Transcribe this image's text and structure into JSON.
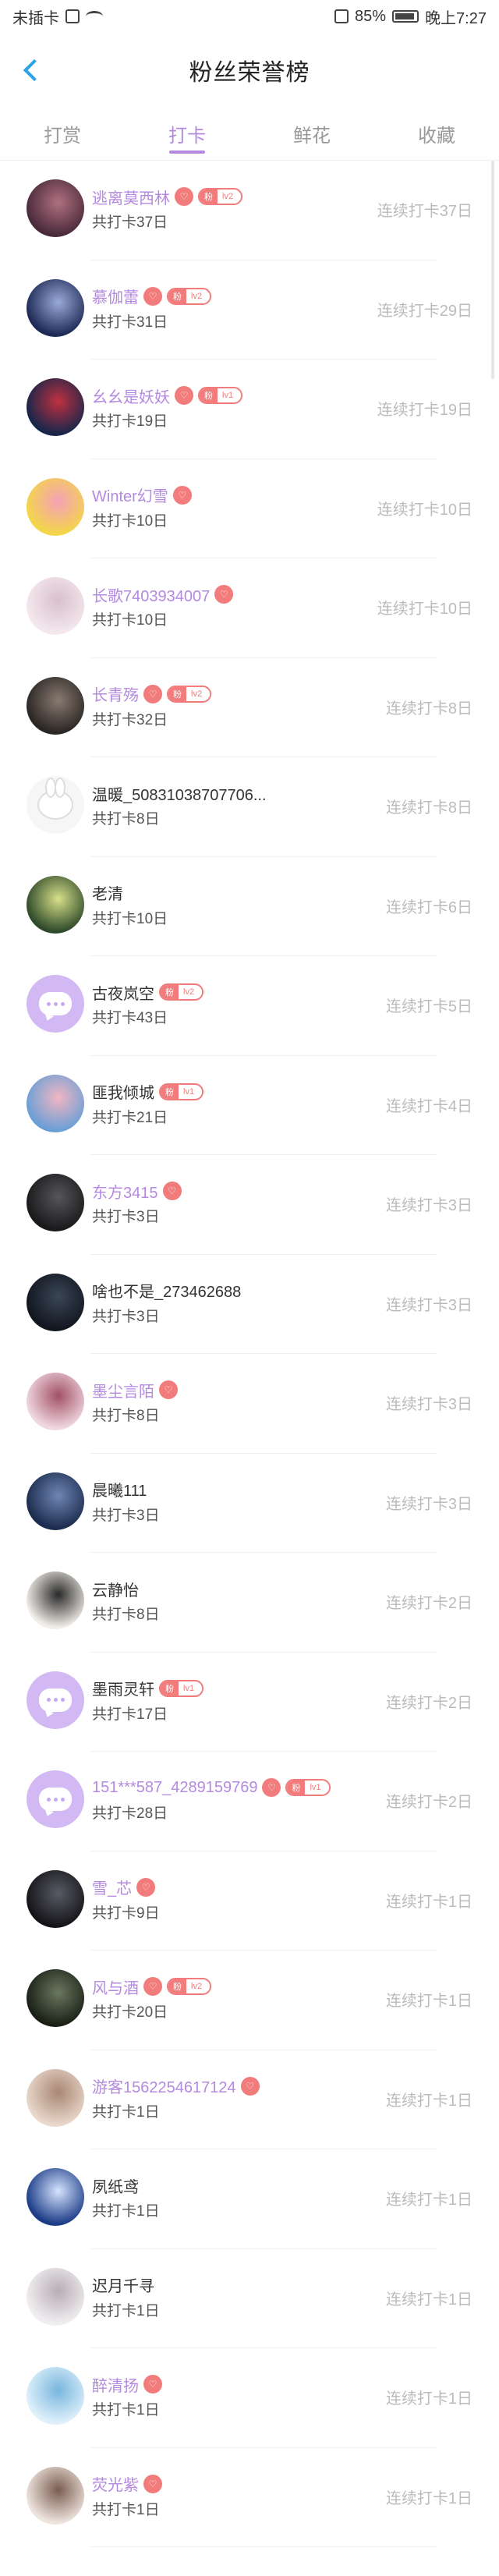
{
  "status_bar": {
    "carrier": "未插卡",
    "battery": "85%",
    "time": "晚上7:27"
  },
  "header": {
    "title": "粉丝荣誉榜"
  },
  "tabs": [
    {
      "label": "打赏",
      "active": false
    },
    {
      "label": "打卡",
      "active": true
    },
    {
      "label": "鲜花",
      "active": false
    },
    {
      "label": "收藏",
      "active": false
    }
  ],
  "colors": {
    "accent": "#b489e0",
    "badge": "#f27b7b",
    "back": "#2aa3e8"
  },
  "badge_fan_label": "粉",
  "rows": [
    {
      "name": "逃离莫西林",
      "purple": true,
      "heart": true,
      "level": "lv2",
      "total": "共打卡37日",
      "streak": "连续打卡37日",
      "avatar": {
        "type": "photo",
        "color": "#4a2a3a",
        "color2": "#b07080"
      }
    },
    {
      "name": "慕伽蕾",
      "purple": true,
      "heart": true,
      "level": "lv2",
      "total": "共打卡31日",
      "streak": "连续打卡29日",
      "avatar": {
        "type": "photo",
        "color": "#1e2a55",
        "color2": "#9aaad8"
      }
    },
    {
      "name": "幺幺是妖妖",
      "purple": true,
      "heart": true,
      "level": "lv1",
      "total": "共打卡19日",
      "streak": "连续打卡19日",
      "avatar": {
        "type": "photo",
        "color": "#18264a",
        "color2": "#c03040"
      }
    },
    {
      "name": "Winter幻雪",
      "purple": true,
      "heart": true,
      "level": "",
      "total": "共打卡10日",
      "streak": "连续打卡10日",
      "avatar": {
        "type": "photo",
        "color": "#f3d64a",
        "color2": "#f5a0b8"
      }
    },
    {
      "name": "长歌7403934007",
      "purple": true,
      "heart": true,
      "level": "",
      "total": "共打卡10日",
      "streak": "连续打卡10日",
      "avatar": {
        "type": "photo",
        "color": "#f4e8ee",
        "color2": "#d8c0cc"
      }
    },
    {
      "name": "长青殇",
      "purple": true,
      "heart": true,
      "level": "lv2",
      "total": "共打卡32日",
      "streak": "连续打卡8日",
      "avatar": {
        "type": "photo",
        "color": "#2a2624",
        "color2": "#8a7a70"
      }
    },
    {
      "name": "温暖_50831038707706...",
      "purple": false,
      "heart": false,
      "level": "",
      "total": "共打卡8日",
      "streak": "连续打卡8日",
      "avatar": {
        "type": "bunny"
      }
    },
    {
      "name": "老清",
      "purple": false,
      "heart": false,
      "level": "",
      "total": "共打卡10日",
      "streak": "连续打卡6日",
      "avatar": {
        "type": "photo",
        "color": "#2f4a2a",
        "color2": "#d8e08a"
      }
    },
    {
      "name": "古夜岚空",
      "purple": false,
      "heart": false,
      "level": "lv2",
      "total": "共打卡43日",
      "streak": "连续打卡5日",
      "avatar": {
        "type": "chat"
      }
    },
    {
      "name": "匪我倾城",
      "purple": false,
      "heart": false,
      "level": "lv1",
      "total": "共打卡21日",
      "streak": "连续打卡4日",
      "avatar": {
        "type": "photo",
        "color": "#6a9fd6",
        "color2": "#f2b6c2"
      }
    },
    {
      "name": "东方3415",
      "purple": true,
      "heart": true,
      "level": "",
      "total": "共打卡3日",
      "streak": "连续打卡3日",
      "avatar": {
        "type": "photo",
        "color": "#1a1a1c",
        "color2": "#55565a"
      }
    },
    {
      "name": "啥也不是_273462688",
      "purple": false,
      "heart": false,
      "level": "",
      "total": "共打卡3日",
      "streak": "连续打卡3日",
      "avatar": {
        "type": "photo",
        "color": "#121620",
        "color2": "#3a4656"
      }
    },
    {
      "name": "墨尘言陌",
      "purple": true,
      "heart": true,
      "level": "",
      "total": "共打卡8日",
      "streak": "连续打卡3日",
      "avatar": {
        "type": "photo",
        "color": "#f0d8e0",
        "color2": "#a25068"
      }
    },
    {
      "name": "晨曦111",
      "purple": false,
      "heart": false,
      "level": "",
      "total": "共打卡3日",
      "streak": "连续打卡3日",
      "avatar": {
        "type": "photo",
        "color": "#1c2c4e",
        "color2": "#6f86b4"
      }
    },
    {
      "name": "云静怡",
      "purple": false,
      "heart": false,
      "level": "",
      "total": "共打卡8日",
      "streak": "连续打卡2日",
      "avatar": {
        "type": "photo",
        "color": "#f1ede8",
        "color2": "#2a2a2a"
      }
    },
    {
      "name": "墨雨灵轩",
      "purple": false,
      "heart": false,
      "level": "lv1",
      "total": "共打卡17日",
      "streak": "连续打卡2日",
      "avatar": {
        "type": "chat"
      }
    },
    {
      "name": "151***587_4289159769",
      "purple": true,
      "heart": true,
      "level": "lv1",
      "total": "共打卡28日",
      "streak": "连续打卡2日",
      "avatar": {
        "type": "chat"
      }
    },
    {
      "name": "雪_芯",
      "purple": true,
      "heart": true,
      "level": "",
      "total": "共打卡9日",
      "streak": "连续打卡1日",
      "avatar": {
        "type": "photo",
        "color": "#141418",
        "color2": "#5a5a66"
      }
    },
    {
      "name": "风与酒",
      "purple": true,
      "heart": true,
      "level": "lv2",
      "total": "共打卡20日",
      "streak": "连续打卡1日",
      "avatar": {
        "type": "photo",
        "color": "#1a2016",
        "color2": "#6a7860"
      }
    },
    {
      "name": "游客1562254617124",
      "purple": true,
      "heart": true,
      "level": "",
      "total": "共打卡1日",
      "streak": "连续打卡1日",
      "avatar": {
        "type": "photo",
        "color": "#e9d8cc",
        "color2": "#a88672"
      }
    },
    {
      "name": "夙纸鸢",
      "purple": false,
      "heart": false,
      "level": "",
      "total": "共打卡1日",
      "streak": "连续打卡1日",
      "avatar": {
        "type": "photo",
        "color": "#1c3c86",
        "color2": "#d6e4ff"
      }
    },
    {
      "name": "迟月千寻",
      "purple": false,
      "heart": false,
      "level": "",
      "total": "共打卡1日",
      "streak": "连续打卡1日",
      "avatar": {
        "type": "photo",
        "color": "#f0eef0",
        "color2": "#b8aeb6"
      }
    },
    {
      "name": "醉清扬",
      "purple": true,
      "heart": true,
      "level": "",
      "total": "共打卡1日",
      "streak": "连续打卡1日",
      "avatar": {
        "type": "photo",
        "color": "#dff0fb",
        "color2": "#78b6de"
      }
    },
    {
      "name": "荧光紫",
      "purple": true,
      "heart": true,
      "level": "",
      "total": "共打卡1日",
      "streak": "连续打卡1日",
      "avatar": {
        "type": "photo",
        "color": "#eee4de",
        "color2": "#7a5c50"
      }
    }
  ]
}
